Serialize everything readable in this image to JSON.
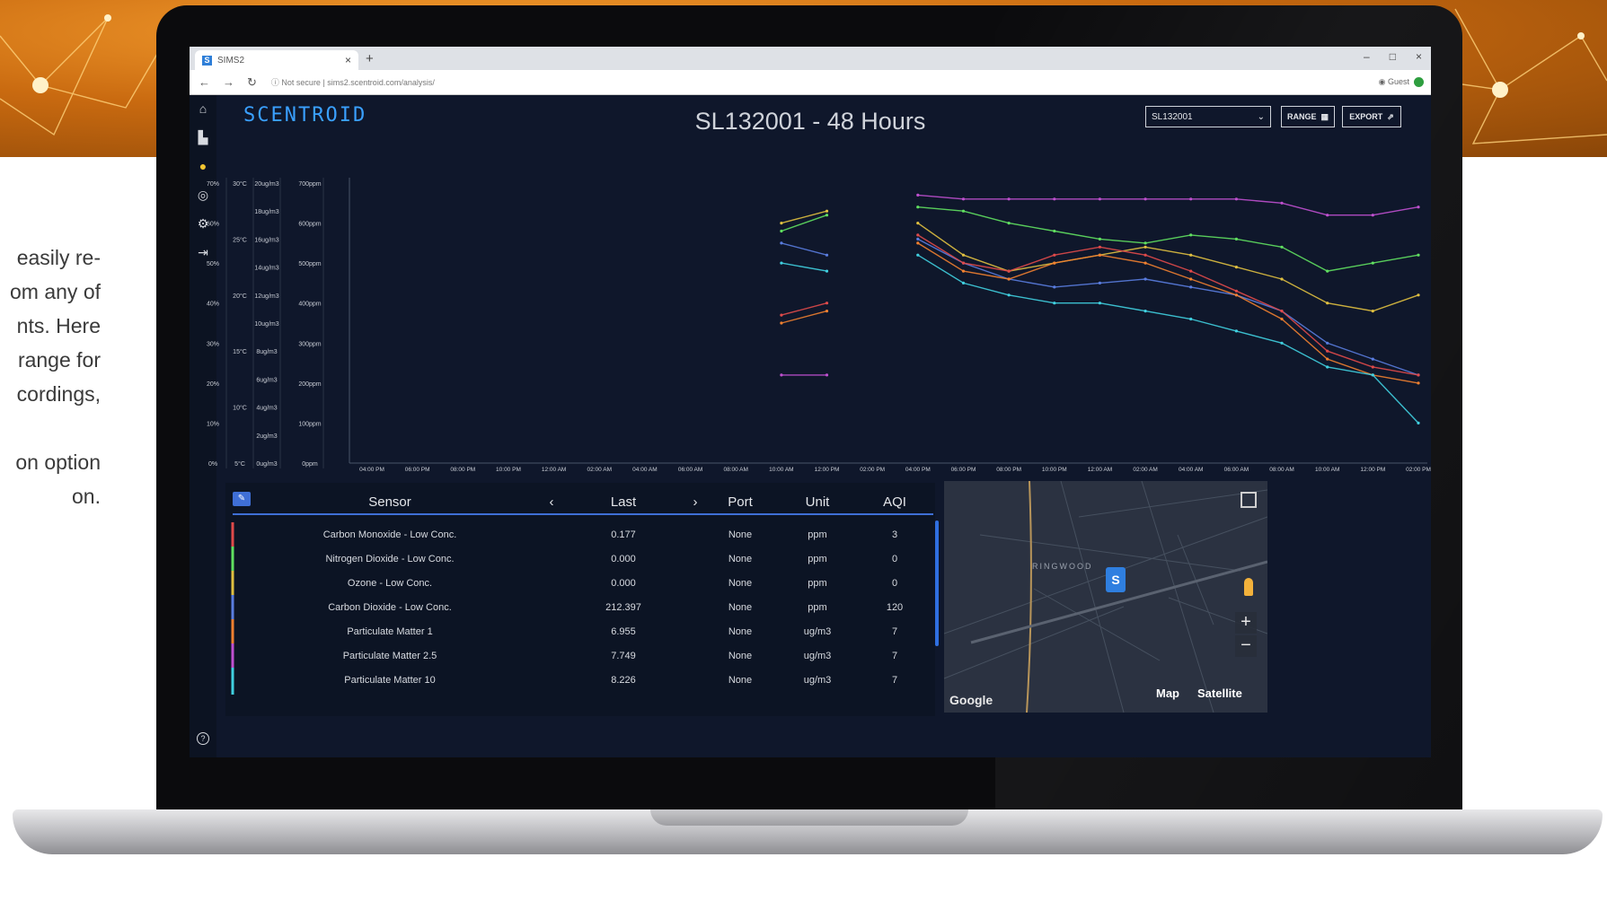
{
  "marketing_text": {
    "lines": [
      "easily re-",
      "om any of",
      "nts. Here",
      "range for",
      "cordings,",
      "on option",
      "on."
    ]
  },
  "browser": {
    "tab_title": "SIMS2",
    "favicon_letter": "S",
    "url_security": "Not secure",
    "url": "sims2.scentroid.com/analysis/",
    "profile_label": "Guest"
  },
  "app": {
    "logo_text": "SCENTROID",
    "chart_title": "SL132001 - 48 Hours",
    "station_select_value": "SL132001",
    "range_button_label": "RANGE",
    "export_button_label": "EXPORT",
    "help_icon_glyph": "?"
  },
  "colors": {
    "background": "#0f172b",
    "accent": "#3f6fd6",
    "series": [
      "#e04a4a",
      "#e0c040",
      "#f0a030",
      "#5a7de0",
      "#f08030",
      "#c050d0",
      "#40d0e0",
      "#60e060"
    ]
  },
  "chart_data": {
    "type": "line",
    "title": "SL132001 - 48 Hours",
    "y_axes": [
      {
        "ticks": [
          "70%",
          "60%",
          "50%",
          "40%",
          "30%",
          "20%",
          "10%",
          "0%"
        ]
      },
      {
        "ticks": [
          "30°C",
          "25°C",
          "20°C",
          "15°C",
          "10°C",
          "5°C"
        ]
      },
      {
        "ticks": [
          "20ug/m3",
          "18ug/m3",
          "16ug/m3",
          "14ug/m3",
          "12ug/m3",
          "10ug/m3",
          "8ug/m3",
          "6ug/m3",
          "4ug/m3",
          "2ug/m3",
          "0ug/m3"
        ]
      },
      {
        "ticks": [
          "700ppm",
          "600ppm",
          "500ppm",
          "400ppm",
          "300ppm",
          "200ppm",
          "100ppm",
          "0ppm"
        ]
      }
    ],
    "x_ticks": [
      "04:00 PM",
      "06:00 PM",
      "08:00 PM",
      "10:00 PM",
      "12:00 AM",
      "02:00 AM",
      "04:00 AM",
      "06:00 AM",
      "08:00 AM",
      "10:00 AM",
      "12:00 PM",
      "02:00 PM",
      "04:00 PM",
      "06:00 PM",
      "08:00 PM",
      "10:00 PM",
      "12:00 AM",
      "02:00 AM",
      "04:00 AM",
      "06:00 AM",
      "08:00 AM",
      "10:00 AM",
      "12:00 PM",
      "02:00 PM"
    ],
    "series": [
      {
        "color": "#c050d0",
        "values": [
          null,
          null,
          null,
          null,
          null,
          null,
          null,
          null,
          null,
          22,
          22,
          null,
          67,
          66,
          66,
          66,
          66,
          66,
          66,
          66,
          65,
          62,
          62,
          64
        ]
      },
      {
        "color": "#60e060",
        "values": [
          null,
          null,
          null,
          null,
          null,
          null,
          null,
          null,
          null,
          58,
          62,
          null,
          64,
          63,
          60,
          58,
          56,
          55,
          57,
          56,
          54,
          48,
          50,
          52
        ]
      },
      {
        "color": "#e0c040",
        "values": [
          null,
          null,
          null,
          null,
          null,
          null,
          null,
          null,
          null,
          60,
          63,
          null,
          60,
          52,
          48,
          50,
          52,
          54,
          52,
          49,
          46,
          40,
          38,
          42
        ]
      },
      {
        "color": "#5a7de0",
        "values": [
          null,
          null,
          null,
          null,
          null,
          null,
          null,
          null,
          null,
          55,
          52,
          null,
          56,
          50,
          46,
          44,
          45,
          46,
          44,
          42,
          38,
          30,
          26,
          22
        ]
      },
      {
        "color": "#f08030",
        "values": [
          null,
          null,
          null,
          null,
          null,
          null,
          null,
          null,
          null,
          35,
          38,
          null,
          55,
          48,
          46,
          50,
          52,
          50,
          46,
          42,
          36,
          26,
          22,
          20
        ]
      },
      {
        "color": "#e04a4a",
        "values": [
          null,
          null,
          null,
          null,
          null,
          null,
          null,
          null,
          null,
          37,
          40,
          null,
          57,
          50,
          48,
          52,
          54,
          52,
          48,
          43,
          38,
          28,
          24,
          22
        ]
      },
      {
        "color": "#40d0e0",
        "values": [
          null,
          null,
          null,
          null,
          null,
          null,
          null,
          null,
          null,
          50,
          48,
          null,
          52,
          45,
          42,
          40,
          40,
          38,
          36,
          33,
          30,
          24,
          22,
          10
        ]
      }
    ]
  },
  "sensor_table": {
    "headers": {
      "sensor": "Sensor",
      "prev": "‹",
      "last": "Last",
      "next": "›",
      "port": "Port",
      "unit": "Unit",
      "aqi": "AQI"
    },
    "rows": [
      {
        "sensor": "Carbon Monoxide - Low Conc.",
        "last": "0.177",
        "port": "None",
        "unit": "ppm",
        "aqi": "3",
        "color": "#e04a4a"
      },
      {
        "sensor": "Nitrogen Dioxide - Low Conc.",
        "last": "0.000",
        "port": "None",
        "unit": "ppm",
        "aqi": "0",
        "color": "#60e060"
      },
      {
        "sensor": "Ozone - Low Conc.",
        "last": "0.000",
        "port": "None",
        "unit": "ppm",
        "aqi": "0",
        "color": "#e0c040"
      },
      {
        "sensor": "Carbon Dioxide - Low Conc.",
        "last": "212.397",
        "port": "None",
        "unit": "ppm",
        "aqi": "120",
        "color": "#5a7de0"
      },
      {
        "sensor": "Particulate Matter 1",
        "last": "6.955",
        "port": "None",
        "unit": "ug/m3",
        "aqi": "7",
        "color": "#f08030"
      },
      {
        "sensor": "Particulate Matter 2.5",
        "last": "7.749",
        "port": "None",
        "unit": "ug/m3",
        "aqi": "7",
        "color": "#c050d0"
      },
      {
        "sensor": "Particulate Matter 10",
        "last": "8.226",
        "port": "None",
        "unit": "ug/m3",
        "aqi": "7",
        "color": "#40d0e0"
      }
    ]
  },
  "map": {
    "district_label": "RINGWOOD",
    "pin_letter": "S",
    "attribution": "Google",
    "map_button": "Map",
    "satellite_button": "Satellite",
    "zoom_in": "+",
    "zoom_out": "−"
  }
}
